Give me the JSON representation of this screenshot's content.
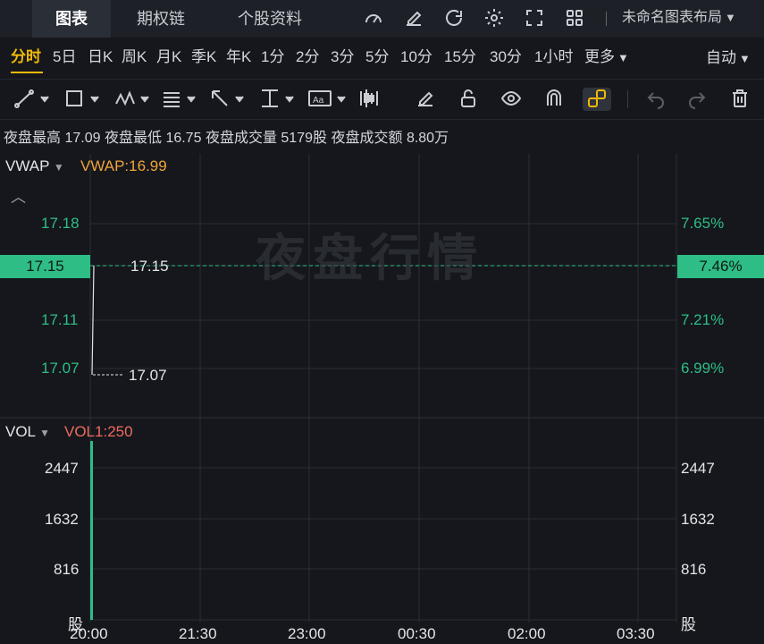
{
  "top_tabs": [
    {
      "label": "图表",
      "active": true
    },
    {
      "label": "期权链",
      "active": false
    },
    {
      "label": "个股资料",
      "active": false
    }
  ],
  "top_icons": [
    "gauge-icon",
    "edit-icon",
    "refresh-icon",
    "settings-icon",
    "expand-icon",
    "grid-icon"
  ],
  "layout_label": "未命名图表布局",
  "periods": [
    {
      "label": "分时",
      "active": true
    },
    {
      "label": "5日"
    },
    {
      "label": "日K"
    },
    {
      "label": "周K"
    },
    {
      "label": "月K"
    },
    {
      "label": "季K"
    },
    {
      "label": "年K"
    },
    {
      "label": "1分"
    },
    {
      "label": "2分"
    },
    {
      "label": "3分"
    },
    {
      "label": "5分"
    },
    {
      "label": "10分"
    },
    {
      "label": "15分"
    },
    {
      "label": "30分"
    },
    {
      "label": "1小时"
    },
    {
      "label": "更多"
    }
  ],
  "auto_label": "自动",
  "info": {
    "high_label": "夜盘最高",
    "high": "17.09",
    "low_label": "夜盘最低",
    "low": "16.75",
    "vol_label": "夜盘成交量",
    "vol": "5179股",
    "amt_label": "夜盘成交额",
    "amt": "8.80万"
  },
  "price_panel": {
    "indicator": "VWAP",
    "indicator_value": "VWAP:16.99",
    "watermark": "夜盘行情",
    "y_left": [
      "17.18",
      "17.15",
      "17.11",
      "17.07"
    ],
    "y_right": [
      "7.65%",
      "7.46%",
      "7.21%",
      "6.99%"
    ],
    "current_price": "17.15",
    "marker_high": "17.15",
    "marker_low": "17.07"
  },
  "vol_panel": {
    "indicator": "VOL",
    "indicator_value": "VOL1:250",
    "y_left": [
      "2447",
      "1632",
      "816",
      "股"
    ],
    "y_right": [
      "2447",
      "1632",
      "816",
      "股"
    ]
  },
  "x_ticks": [
    "20:00",
    "21:30",
    "23:00",
    "00:30",
    "02:00",
    "03:30"
  ],
  "colors": {
    "accent": "#f0b90b",
    "up": "#2ebd85",
    "vol_label": "#ef6b5e",
    "vwap_label": "#f0a33c"
  },
  "chart_data": {
    "type": "line",
    "x": [
      "20:00",
      "20:00"
    ],
    "series": [
      {
        "values": [
          17.07,
          17.15
        ]
      }
    ],
    "volume": [
      2447
    ],
    "xlabel": "",
    "ylabel": "",
    "ylim": [
      17.05,
      17.2
    ]
  }
}
